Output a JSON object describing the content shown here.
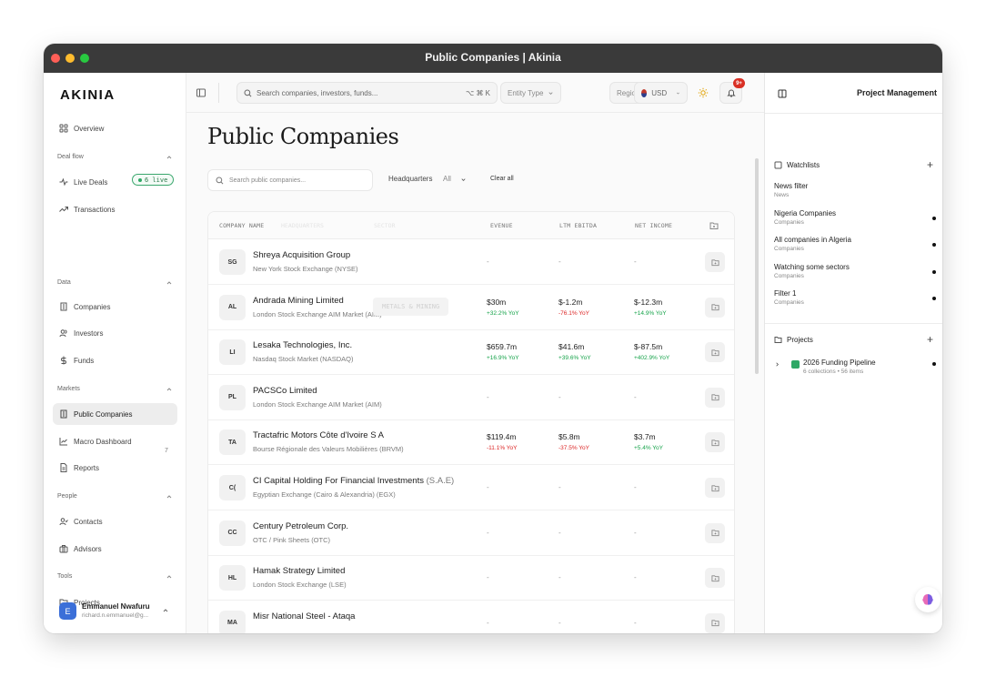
{
  "window": {
    "title": "Public Companies | Akinia"
  },
  "sidebar": {
    "logo": "AKINIA",
    "overview": "Overview",
    "sections": {
      "dealflow": "Deal flow",
      "data": "Data",
      "markets": "Markets",
      "people": "People",
      "tools": "Tools"
    },
    "items": {
      "live_deals": "Live Deals",
      "live_badge": "6 live",
      "transactions": "Transactions",
      "companies": "Companies",
      "investors": "Investors",
      "funds": "Funds",
      "public_companies": "Public Companies",
      "macro_dashboard": "Macro Dashboard",
      "reports": "Reports",
      "reports_count": "7",
      "contacts": "Contacts",
      "advisors": "Advisors",
      "projects": "Projects"
    },
    "user": {
      "initial": "E",
      "name": "Emmanuel Nwafuru",
      "email": "richard.n.emmanuel@g..."
    }
  },
  "topbar": {
    "search_placeholder": "Search companies, investors, funds...",
    "search_shortcut": "⌥ ⌘ K",
    "entity_type": "Entity Type",
    "region": "Region",
    "currency": "USD",
    "notifications_badge": "9+"
  },
  "main": {
    "title": "Public Companies",
    "search_placeholder": "Search public companies...",
    "hq_label": "Headquarters",
    "hq_value": "All",
    "clear_all": "Clear all",
    "columns": {
      "company": "COMPANY NAME",
      "headquarters": "HEADQUARTERS",
      "sector": "SECTOR",
      "revenue": "EVENUE",
      "ebitda": "LTM EBITDA",
      "net_income": "NET INCOME"
    },
    "rows": [
      {
        "initials": "SG",
        "name": "Shreya Acquisition Group",
        "suffix": "",
        "exchange": "New York Stock Exchange (NYSE)",
        "revenue": "-",
        "revenue_yoy": "",
        "ebitda": "-",
        "ebitda_yoy": "",
        "net_income": "-",
        "net_income_yoy": ""
      },
      {
        "initials": "AL",
        "name": "Andrada Mining Limited",
        "suffix": "",
        "exchange": "London Stock Exchange AIM Market (AIM)",
        "tag": "METALS & MINING",
        "revenue": "$30m",
        "revenue_yoy": "+32.2% YoY",
        "ebitda": "$-1.2m",
        "ebitda_yoy": "-76.1% YoY",
        "net_income": "$-12.3m",
        "net_income_yoy": "+14.9% YoY"
      },
      {
        "initials": "LI",
        "name": "Lesaka Technologies, Inc.",
        "suffix": "",
        "exchange": "Nasdaq Stock Market (NASDAQ)",
        "revenue": "$659.7m",
        "revenue_yoy": "+16.9% YoY",
        "ebitda": "$41.6m",
        "ebitda_yoy": "+39.6% YoY",
        "net_income": "$-87.5m",
        "net_income_yoy": "+402.9% YoY"
      },
      {
        "initials": "PL",
        "name": "PACSCo Limited",
        "suffix": "",
        "exchange": "London Stock Exchange AIM Market (AIM)",
        "revenue": "-",
        "revenue_yoy": "",
        "ebitda": "-",
        "ebitda_yoy": "",
        "net_income": "-",
        "net_income_yoy": ""
      },
      {
        "initials": "TA",
        "name": "Tractafric Motors Côte d'Ivoire S A",
        "suffix": "",
        "exchange": "Bourse Régionale des Valeurs Mobilières (BRVM)",
        "revenue": "$119.4m",
        "revenue_yoy": "-11.1% YoY",
        "ebitda": "$5.8m",
        "ebitda_yoy": "-37.5% YoY",
        "net_income": "$3.7m",
        "net_income_yoy": "+5.4% YoY"
      },
      {
        "initials": "C(",
        "name": "CI Capital Holding For Financial Investments",
        "suffix": " (S.A.E)",
        "exchange": "Egyptian Exchange (Cairo & Alexandria) (EGX)",
        "revenue": "-",
        "revenue_yoy": "",
        "ebitda": "-",
        "ebitda_yoy": "",
        "net_income": "-",
        "net_income_yoy": ""
      },
      {
        "initials": "CC",
        "name": "Century Petroleum Corp.",
        "suffix": "",
        "exchange": "OTC / Pink Sheets (OTC)",
        "revenue": "-",
        "revenue_yoy": "",
        "ebitda": "-",
        "ebitda_yoy": "",
        "net_income": "-",
        "net_income_yoy": ""
      },
      {
        "initials": "HL",
        "name": "Hamak Strategy Limited",
        "suffix": "",
        "exchange": "London Stock Exchange (LSE)",
        "revenue": "-",
        "revenue_yoy": "",
        "ebitda": "-",
        "ebitda_yoy": "",
        "net_income": "-",
        "net_income_yoy": ""
      },
      {
        "initials": "MA",
        "name": "Misr National Steel - Ataqa",
        "suffix": "",
        "exchange": "",
        "revenue": "-",
        "revenue_yoy": "",
        "ebitda": "-",
        "ebitda_yoy": "",
        "net_income": "-",
        "net_income_yoy": ""
      }
    ]
  },
  "right_panel": {
    "title": "Project Management",
    "watchlists_label": "Watchlists",
    "watchlists": [
      {
        "name": "News filter",
        "sub": "News",
        "dot": false
      },
      {
        "name": "Nigeria Companies",
        "sub": "Companies",
        "dot": true
      },
      {
        "name": "All companies in Algeria",
        "sub": "Companies",
        "dot": true
      },
      {
        "name": "Watching some sectors",
        "sub": "Companies",
        "dot": true
      },
      {
        "name": "Filter 1",
        "sub": "Companies",
        "dot": true
      }
    ],
    "projects_label": "Projects",
    "project": {
      "name": "2026 Funding Pipeline",
      "sub": "6 collections • 56 items"
    }
  },
  "colors": {
    "positive": "#16a34a",
    "negative": "#dc2626",
    "accent": "#2fa866",
    "badge": "#d93025"
  }
}
